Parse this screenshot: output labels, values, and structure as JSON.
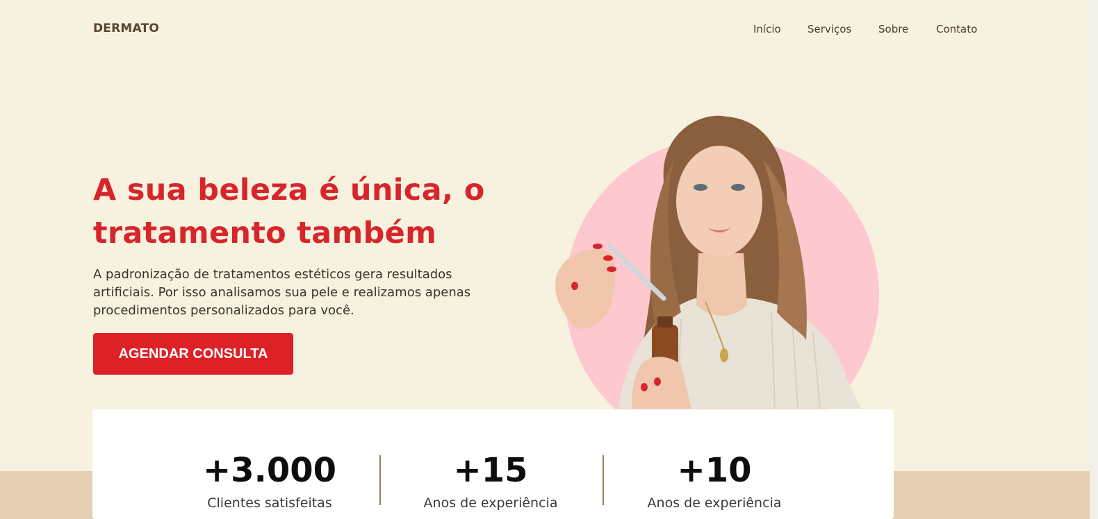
{
  "brand": {
    "logo": "DERMATO"
  },
  "nav": {
    "items": [
      {
        "label": "Início"
      },
      {
        "label": "Serviços"
      },
      {
        "label": "Sobre"
      },
      {
        "label": "Contato"
      }
    ]
  },
  "hero": {
    "title": "A sua beleza é única, o tratamento também",
    "description": "A padronização de tratamentos estéticos gera resultados artificiais. Por isso analisamos sua pele e realizamos apenas procedimentos personalizados para você.",
    "cta_label": "AGENDAR CONSULTA",
    "image_subject": "woman holding dropper bottle"
  },
  "stats": [
    {
      "value": "+3.000",
      "label": "Clientes satisfeitas"
    },
    {
      "value": "+15",
      "label": "Anos de experiência"
    },
    {
      "value": "+10",
      "label": "Anos de experiência"
    }
  ],
  "colors": {
    "background": "#f7f1df",
    "accent": "#dc2227",
    "circle": "#fec8cf",
    "band": "#e5cfb2",
    "divider": "#9b7d5a"
  }
}
